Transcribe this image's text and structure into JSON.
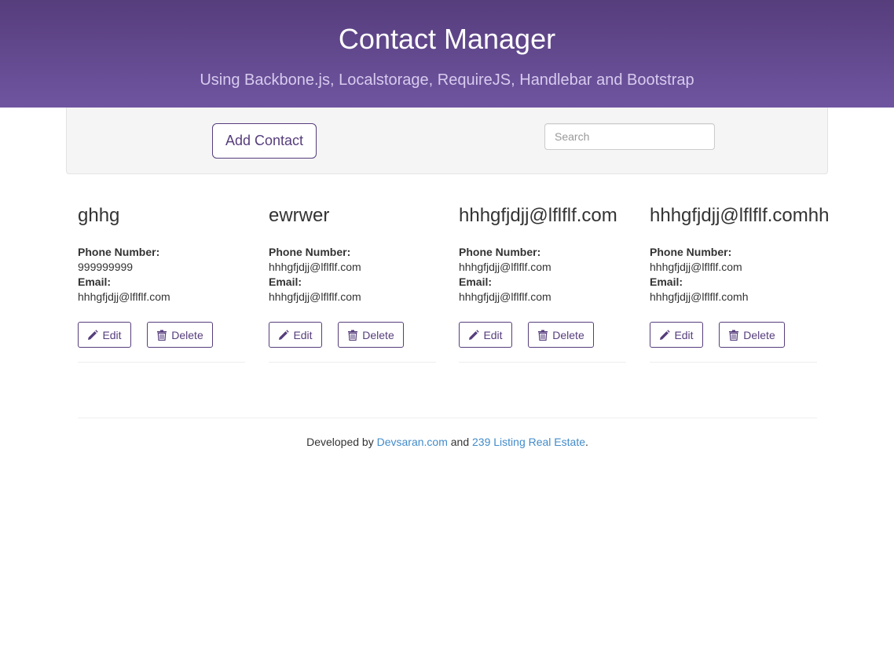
{
  "header": {
    "title": "Contact Manager",
    "subtitle": "Using Backbone.js, Localstorage, RequireJS, Handlebar and Bootstrap"
  },
  "toolbar": {
    "add_label": "Add Contact",
    "search_placeholder": "Search",
    "search_value": ""
  },
  "labels": {
    "phone": "Phone Number:",
    "email": "Email:",
    "edit": "Edit",
    "delete": "Delete"
  },
  "contacts": [
    {
      "name": "ghhg",
      "phone": "999999999",
      "email": "hhhgfjdjj@lflflf.com"
    },
    {
      "name": "ewrwer",
      "phone": "hhhgfjdjj@lflflf.com",
      "email": "hhhgfjdjj@lflflf.com"
    },
    {
      "name": "hhhgfjdjj@lflflf.com",
      "phone": "hhhgfjdjj@lflflf.com",
      "email": "hhhgfjdjj@lflflf.com"
    },
    {
      "name": "hhhgfjdjj@lflflf.comhh",
      "phone": "hhhgfjdjj@lflflf.com",
      "email": "hhhgfjdjj@lflflf.comh"
    }
  ],
  "footer": {
    "prefix": "Developed by",
    "link1": "Devsaran.com",
    "middle": "and",
    "link2": "239 Listing Real Estate",
    "suffix": "."
  },
  "icons": {
    "edit": "pencil-icon",
    "delete": "trash-icon"
  },
  "colors": {
    "brand": "#563d7c",
    "link": "#428bca"
  }
}
